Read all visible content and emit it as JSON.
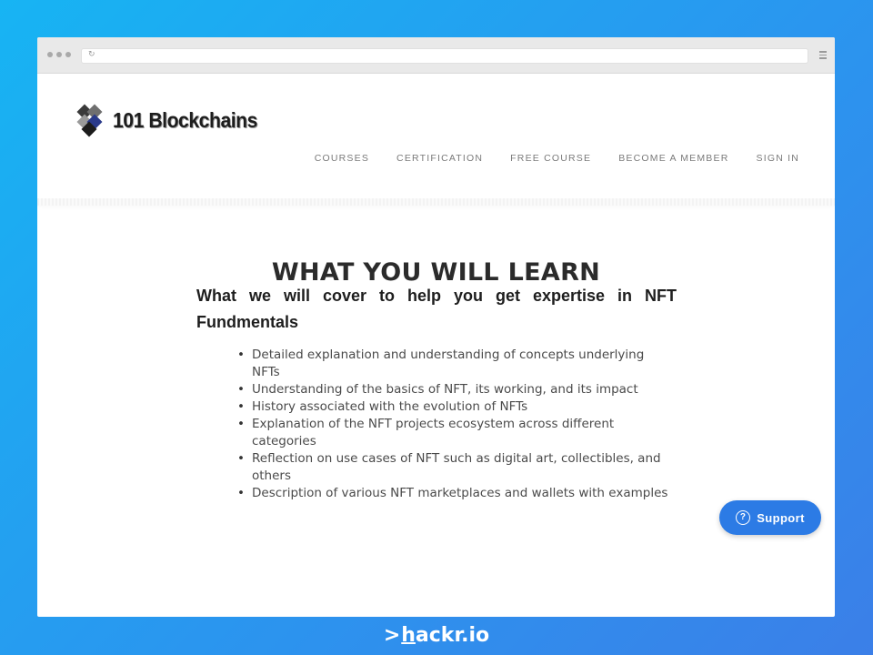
{
  "browser": {
    "window_dots": 3,
    "reload_icon": "reload-icon",
    "menu_icon": "menu-icon"
  },
  "header": {
    "logo_text": "101 Blockchains",
    "logo_icon": "cube-logo-icon",
    "nav": [
      {
        "label": "COURSES"
      },
      {
        "label": "CERTIFICATION"
      },
      {
        "label": "FREE COURSE"
      },
      {
        "label": "BECOME A MEMBER"
      },
      {
        "label": "SIGN IN"
      }
    ]
  },
  "main": {
    "title": "WHAT YOU WILL LEARN",
    "subtitle": "What we will cover to help you get expertise in NFT Fundmentals",
    "topics": [
      "Detailed explanation and understanding of concepts underlying NFTs",
      "Understanding of the basics of NFT, its working, and its impact",
      "History associated with the evolution of NFTs",
      "Explanation of the NFT projects ecosystem across different categories",
      "Reflection on use cases of NFT such as digital art, collectibles, and others",
      "Description of various NFT marketplaces and wallets with examples"
    ]
  },
  "support": {
    "label": "Support",
    "icon": "question-circle-icon",
    "icon_glyph": "?"
  },
  "watermark": {
    "caret": ">",
    "h": "h",
    "rest": "ackr.io"
  },
  "colors": {
    "background_start": "#17b4f3",
    "background_end": "#3b7fe8",
    "support_button": "#2c7be5",
    "nav_text": "#7a7a7a"
  }
}
